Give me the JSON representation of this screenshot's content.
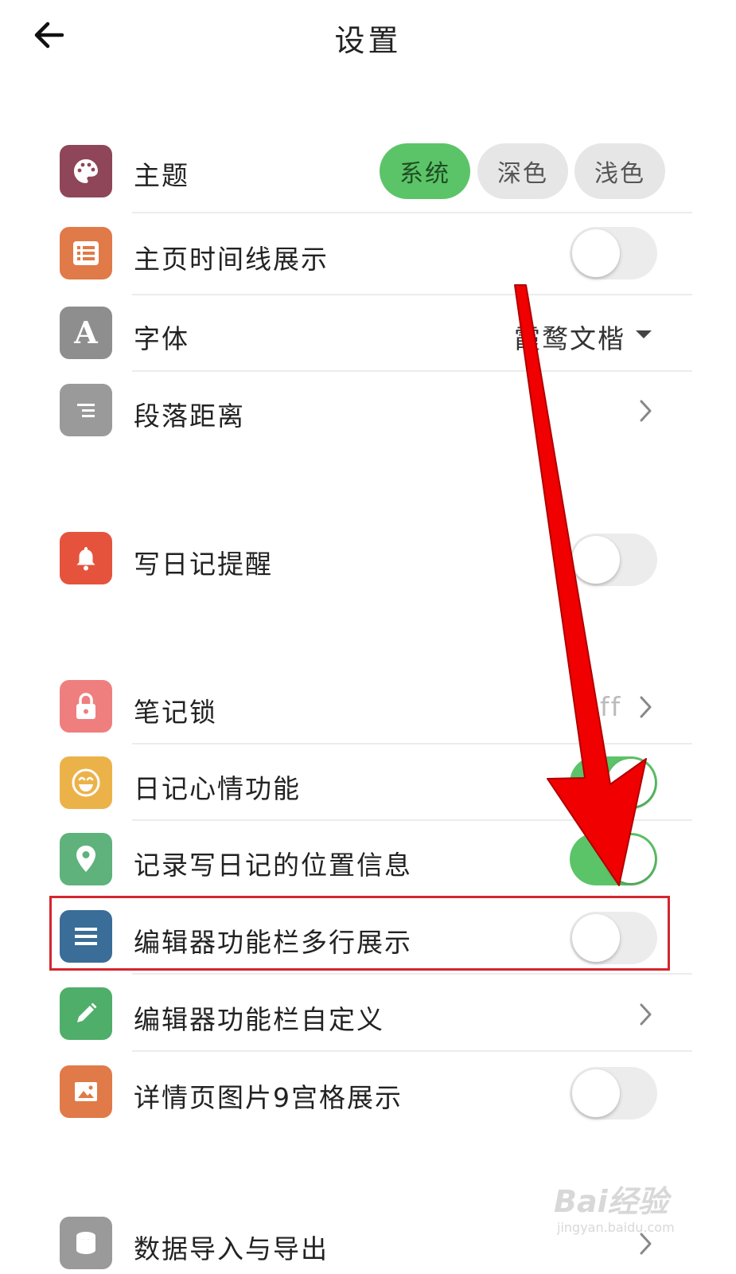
{
  "header": {
    "title": "设置"
  },
  "theme": {
    "label": "主题",
    "options": [
      "系统",
      "深色",
      "浅色"
    ],
    "selected": "系统"
  },
  "timeline": {
    "label": "主页时间线展示",
    "toggle_on": false
  },
  "font": {
    "label": "字体",
    "value": "霞鹜文楷"
  },
  "paragraph": {
    "label": "段落距离"
  },
  "reminder": {
    "label": "写日记提醒",
    "toggle_on": false
  },
  "lock": {
    "label": "笔记锁",
    "value": "ff"
  },
  "mood": {
    "label": "日记心情功能",
    "toggle_on": true
  },
  "location": {
    "label": "记录写日记的位置信息",
    "toggle_on": true
  },
  "toolbar_multiline": {
    "label": "编辑器功能栏多行展示",
    "toggle_on": false
  },
  "toolbar_custom": {
    "label": "编辑器功能栏自定义"
  },
  "grid9": {
    "label": "详情页图片9宫格展示",
    "toggle_on": false
  },
  "data_io": {
    "label": "数据导入与导出"
  },
  "watermark": {
    "brand": "Bai经验",
    "url": "jingyan.baidu.com"
  },
  "colors": {
    "accent_green": "#5cc468",
    "theme_icon": "#8e4658",
    "timeline_icon": "#e07a48",
    "font_icon": "#8e8e8e",
    "paragraph_icon": "#9a9a9a",
    "reminder_icon": "#e5533d",
    "lock_icon": "#ef7f7f",
    "mood_icon": "#ecb24a",
    "location_icon": "#5fb27c",
    "toolbar_icon": "#3a6d98",
    "custom_icon": "#4fae6a",
    "image_icon": "#e07a48",
    "data_icon": "#9a9a9a",
    "arrow_red": "#f00000",
    "highlight_border": "#d4262e"
  }
}
